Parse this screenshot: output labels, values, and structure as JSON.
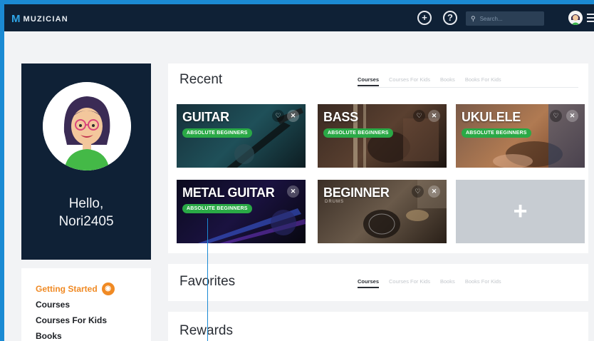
{
  "app": {
    "logo_mark": "M",
    "logo_text": "MUZICIAN"
  },
  "topbar": {
    "add_icon": "+",
    "help_icon": "?",
    "search_placeholder": "Search..."
  },
  "profile": {
    "greeting": "Hello,",
    "username": "Nori2405"
  },
  "sidebar": {
    "items": [
      {
        "label": "Getting Started",
        "active": true
      },
      {
        "label": "Courses"
      },
      {
        "label": "Courses For Kids"
      },
      {
        "label": "Books"
      }
    ]
  },
  "recent": {
    "title": "Recent",
    "tabs": [
      "Courses",
      "Courses For Kids",
      "Books",
      "Books For Kids"
    ],
    "cards": [
      {
        "title": "GUITAR",
        "badge": "ABSOLUTE BEGINNERS"
      },
      {
        "title": "BASS",
        "badge": "ABSOLUTE BEGINNERS"
      },
      {
        "title": "UKULELE",
        "badge": "ABSOLUTE BEGINNERS"
      },
      {
        "title": "METAL GUITAR",
        "badge": "ABSOLUTE BEGINNERS"
      },
      {
        "title": "BEGINNER",
        "subtitle": "DRUMS"
      }
    ],
    "add_label": "+"
  },
  "favorites": {
    "title": "Favorites",
    "tabs": [
      "Courses",
      "Courses For Kids",
      "Books",
      "Books For Kids"
    ]
  },
  "rewards": {
    "title": "Rewards"
  },
  "colors": {
    "topbar": "#0f2136",
    "profile_card": "#0f2136",
    "accent_orange": "#f08a24",
    "badge_green": "#2aa946",
    "frame_blue": "#1b8ad3"
  }
}
